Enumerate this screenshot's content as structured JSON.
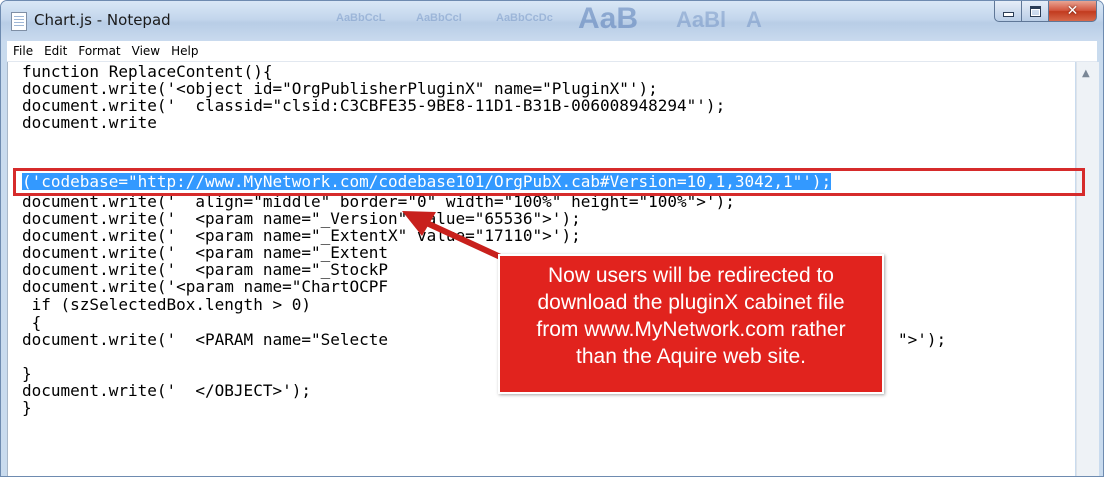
{
  "window": {
    "title": "Chart.js - Notepad",
    "background_ribbon": [
      "AaBbCcL",
      "AaBbCcI",
      "AaBbCcDc",
      "AaB",
      "AaBl",
      "A"
    ],
    "caption_buttons": {
      "minimize": "minimize-icon",
      "maximize": "maximize-icon",
      "close": "✕"
    }
  },
  "menu": [
    "File",
    "Edit",
    "Format",
    "View",
    "Help"
  ],
  "editor": {
    "lines": [
      "function ReplaceContent(){",
      "document.write('<object id=\"OrgPublisherPluginX\" name=\"PluginX\"');",
      "document.write('  classid=\"clsid:C3CBFE35-9BE8-11D1-B31B-006008948294\"');",
      "document.write",
      "('codebase=\"http://www.MyNetwork.com/codebase101/OrgPubX.cab#Version=10,1,3042,1\"');",
      "document.write('  align=\"middle\" border=\"0\" width=\"100%\" height=\"100%\">');",
      "document.write('  <param name=\"_Version\" value=\"65536\">');",
      "document.write('  <param name=\"_ExtentX\" value=\"17110\">');",
      "document.write('  <param name=\"_Extent",
      "document.write('  <param name=\"_StockP",
      "document.write('<param name=\"ChartOCPF",
      " if (szSelectedBox.length > 0)",
      " {",
      "document.write('  <PARAM name=\"Selecte",
      "",
      "}",
      "document.write('  </OBJECT>');",
      "}"
    ],
    "line_13_tail": "\">');",
    "selected_line_index": 4
  },
  "annotation": {
    "callout_text": "Now users will be redirected to download the pluginX cabinet file from www.MyNetwork.com rather than the Aquire web site.",
    "callout_lines": [
      "Now users will be redirected to",
      "download the pluginX cabinet file",
      "from www.MyNetwork.com rather",
      "than the Aquire web site."
    ],
    "highlight_color": "#d62b2b",
    "callout_color": "#e1231e"
  },
  "colors": {
    "selection": "#3399ff",
    "titlebar": "#c3d6ec"
  }
}
